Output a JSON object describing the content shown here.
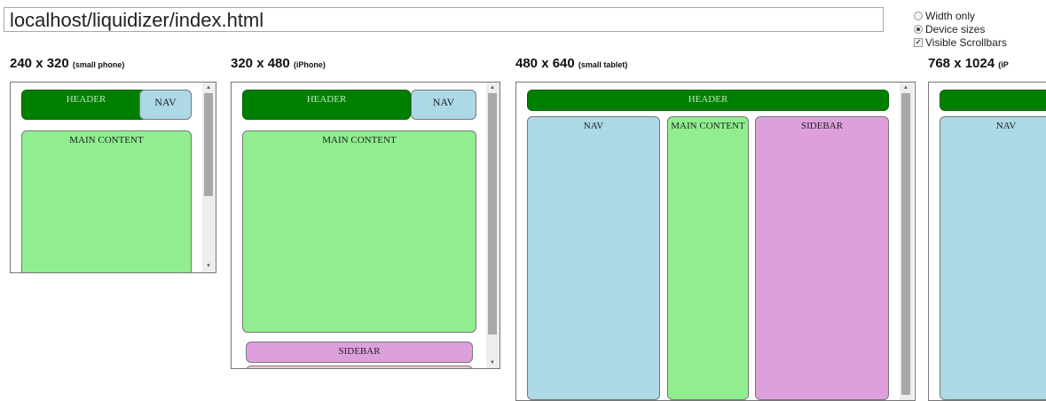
{
  "address_bar": {
    "url": "localhost/liquidizer/index.html"
  },
  "options": [
    {
      "label": "Width only",
      "type": "radio",
      "checked": false
    },
    {
      "label": "Device sizes",
      "type": "radio",
      "checked": true
    },
    {
      "label": "Visible Scrollbars",
      "type": "checkbox",
      "checked": true
    }
  ],
  "devices": [
    {
      "size": "240 x 320",
      "desc": "(small phone)",
      "header": "HEADER",
      "nav": "NAV",
      "main": "MAIN CONTENT"
    },
    {
      "size": "320 x 480",
      "desc": "(iPhone)",
      "header": "HEADER",
      "nav": "NAV",
      "main": "MAIN CONTENT",
      "sidebar": "SIDEBAR"
    },
    {
      "size": "480 x 640",
      "desc": "(small tablet)",
      "header": "HEADER",
      "nav": "NAV",
      "main": "MAIN CONTENT",
      "sidebar": "SIDEBAR"
    },
    {
      "size": "768 x 1024",
      "desc": "(iP",
      "nav": "NAV"
    }
  ],
  "colors": {
    "header": "#008000",
    "nav": "#add8e6",
    "main": "#90ee90",
    "sidebar": "#dda0dd"
  }
}
